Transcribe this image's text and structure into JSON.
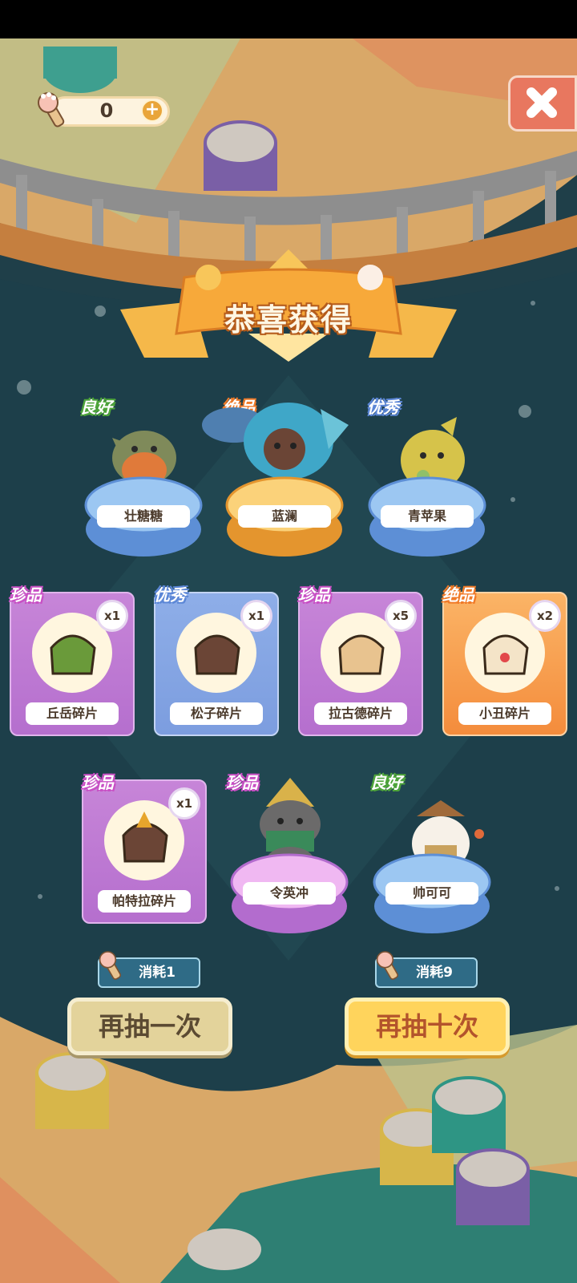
{
  "currency": {
    "value": "0",
    "plus_label": "+",
    "icon": "paw-token-icon"
  },
  "close": {
    "icon": "close-icon"
  },
  "banner": {
    "title": "恭喜获得"
  },
  "rewards_row1": [
    {
      "rarity": "良好",
      "name": "壮糖糖",
      "type": "character"
    },
    {
      "rarity": "绝品",
      "name": "蓝澜",
      "type": "character"
    },
    {
      "rarity": "优秀",
      "name": "青苹果",
      "type": "character"
    }
  ],
  "fragments": [
    {
      "rarity": "珍品",
      "name": "丘岳碎片",
      "count": "x1"
    },
    {
      "rarity": "优秀",
      "name": "松子碎片",
      "count": "x1"
    },
    {
      "rarity": "珍品",
      "name": "拉古德碎片",
      "count": "x5"
    },
    {
      "rarity": "绝品",
      "name": "小丑碎片",
      "count": "x2"
    }
  ],
  "rewards_row3": [
    {
      "rarity": "珍品",
      "name": "帕特拉碎片",
      "count": "x1",
      "type": "fragment"
    },
    {
      "rarity": "珍品",
      "name": "令英冲",
      "type": "character"
    },
    {
      "rarity": "良好",
      "name": "帅可可",
      "type": "character"
    }
  ],
  "actions": {
    "once": {
      "cost_label": "消耗1",
      "label": "再抽一次"
    },
    "ten": {
      "cost_label": "消耗9",
      "label": "再抽十次"
    }
  },
  "colors": {
    "rarity_good": "#4ea53a",
    "rarity_best": "#f07a28",
    "rarity_excellent": "#5b86d6",
    "rarity_rare": "#c84fc4"
  }
}
